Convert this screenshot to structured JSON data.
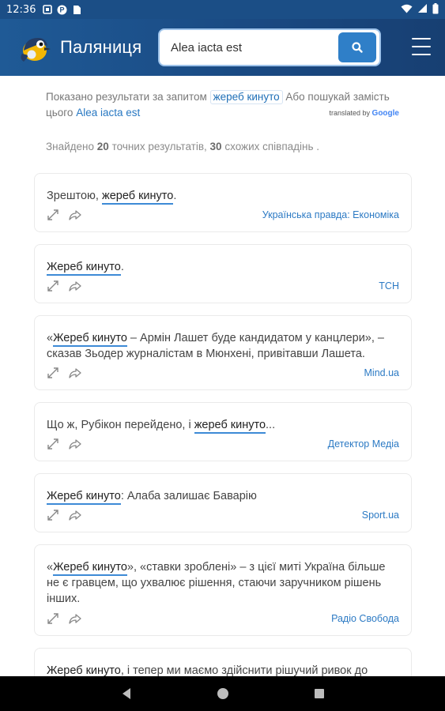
{
  "status_bar": {
    "time": "12:36"
  },
  "header": {
    "app_title": "Паляниця",
    "search_value": "Alea iacta est",
    "colors": {
      "header_bg": "#1a4a83",
      "accent": "#2f7fc8"
    }
  },
  "translation": {
    "prefix": "Показано результати за запитом",
    "query": "жереб кинуто",
    "middle": "Або пошукай замість цього",
    "alt_query": "Alea iacta est",
    "attr_prefix": "translated by",
    "attr_brand": "Google"
  },
  "results_summary": {
    "prefix": "Знайдено",
    "exact_count": "20",
    "exact_label": "точних результатів,",
    "similar_count": "30",
    "similar_label": "схожих співпадінь ."
  },
  "results": [
    {
      "before": "Зрештою, ",
      "highlight": "жереб кинуто",
      "after": ".",
      "source": "Українська правда: Економіка"
    },
    {
      "before": "",
      "highlight": "Жереб кинуто",
      "after": ".",
      "source": "ТСН"
    },
    {
      "before": "«",
      "highlight": "Жереб кинуто",
      "after": " – Армін Лашет буде кандидатом у канцлери», – сказав Зьодер журналістам в Мюнхені, привітавши Лашета.",
      "source": "Mind.ua"
    },
    {
      "before": "Що ж, Рубікон перейдено, і ",
      "highlight": "жереб кинуто",
      "after": "...",
      "source": "Детектор Медіа"
    },
    {
      "before": "",
      "highlight": "Жереб кинуто",
      "after": ": Алаба залишає Баварію",
      "source": "Sport.ua"
    },
    {
      "before": "«",
      "highlight": "Жереб кинуто",
      "after": "», «ставки зроблені» – з цієї миті Україна більше не є гравцем, що ухвалює рішення, стаючи заручником рішень інших.",
      "source": "Радіо Свобода"
    },
    {
      "before": "",
      "highlight": "Жереб кинуто",
      "after": ", і тепер ми маємо здійснити рішучий ривок до",
      "source": ""
    }
  ],
  "icons": {
    "search": "search-icon",
    "menu": "hamburger-menu-icon",
    "expand": "expand-icon",
    "share": "share-icon"
  }
}
